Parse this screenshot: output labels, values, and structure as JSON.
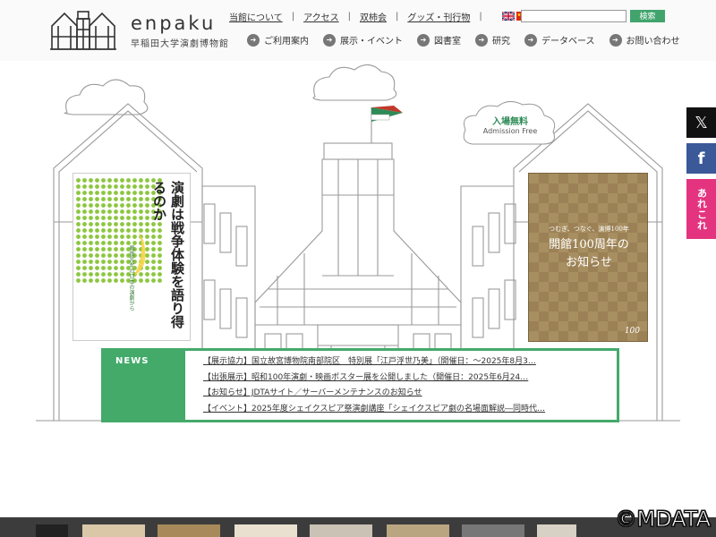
{
  "logo": {
    "en": "enpaku",
    "ja": "早稲田大学演劇博物館"
  },
  "topnav": {
    "items": [
      "当館について",
      "アクセス",
      "双柿会",
      "グッズ・刊行物"
    ],
    "separator": "|"
  },
  "languages": [
    {
      "icon": "uk-flag-icon"
    },
    {
      "icon": "china-flag-icon"
    },
    {
      "icon": "korea-flag-icon"
    }
  ],
  "search": {
    "placeholder": "",
    "button_label": "検索"
  },
  "mainnav": {
    "items": [
      "ご利用案内",
      "展示・イベント",
      "図書室",
      "研究",
      "データベース",
      "お問い合わせ"
    ]
  },
  "hero": {
    "admission_ja": "入場無料",
    "admission_en": "Admission Free",
    "poster_left": {
      "title": "演劇は戦争体験を語り得るのか",
      "subtitle": "戦後80年の日本の演劇から"
    },
    "poster_right": {
      "small_text": "つむぎ、つなぐ、演博100年",
      "title_line1": "開館100周年の",
      "title_line2": "お知らせ",
      "mark": "100"
    }
  },
  "news": {
    "label": "NEWS",
    "items": [
      "【展示協力】国立故宮博物院南部院区　特別展「江戸浮世乃美」（開催日：～2025年8月3…",
      "【出張展示】昭和100年演劇・映画ポスター展を公開しました（開催日：2025年6月24…",
      "【お知らせ】JDTAサイト／サーバーメンテナンスのお知らせ",
      "【イベント】2025年度シェイクスピア祭演劇講座「シェイクスピア劇の名場面解説―同時代…"
    ]
  },
  "social": {
    "x": "𝕏",
    "facebook": "f",
    "arekore": "あれこれ"
  },
  "watermark": "©MDATA",
  "colors": {
    "accent_green": "#44aa6a",
    "facebook_blue": "#3b5998",
    "arekore_pink": "#e4347f"
  }
}
